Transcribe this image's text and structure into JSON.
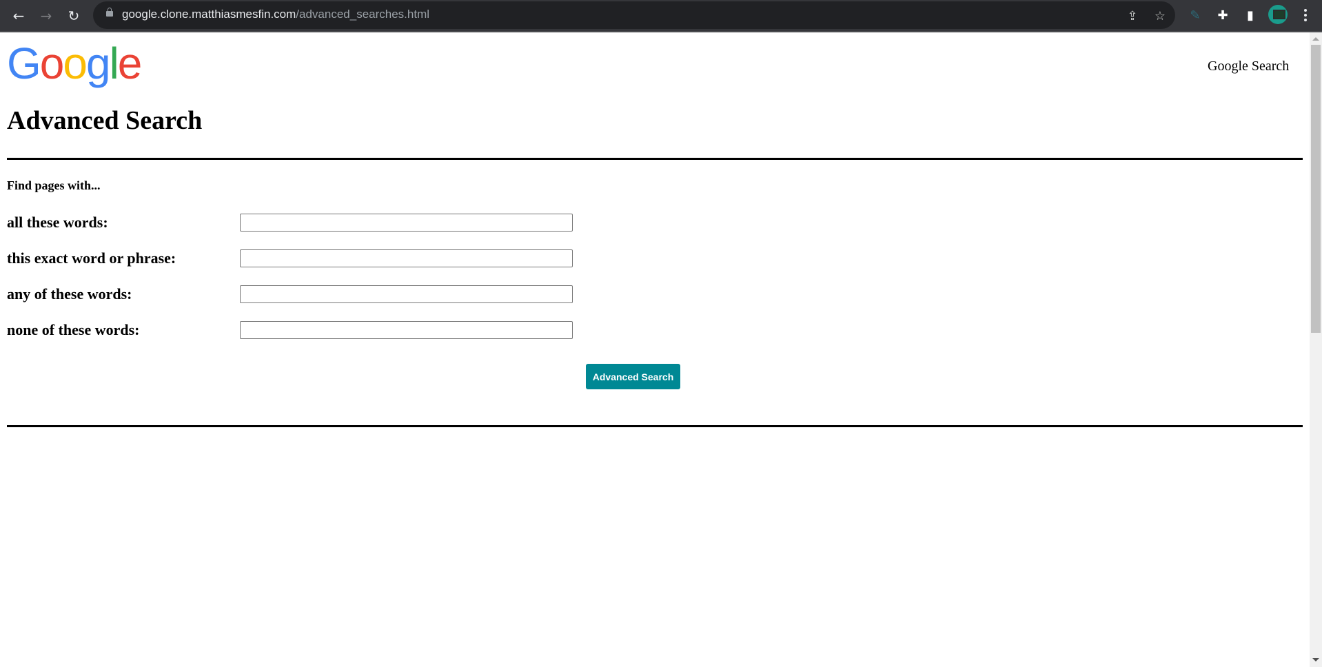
{
  "browser": {
    "url_host": "google.clone.matthiasmesfin.com",
    "url_path": "/advanced_searches.html",
    "back_icon": "←",
    "forward_icon": "→",
    "reload_icon": "↻",
    "share_icon": "⇪",
    "star_icon": "☆",
    "extension_icon": "✎",
    "puzzle_icon": "✚",
    "sidepanel_icon": "▮"
  },
  "header": {
    "logo": [
      "G",
      "o",
      "o",
      "g",
      "l",
      "e"
    ],
    "google_search_link": "Google Search"
  },
  "main": {
    "title": "Advanced Search",
    "subtitle": "Find pages with...",
    "fields": [
      {
        "label": "all these words:",
        "value": "",
        "placeholder": ""
      },
      {
        "label": "this exact word or phrase:",
        "value": "",
        "placeholder": ""
      },
      {
        "label": "any of these words:",
        "value": "",
        "placeholder": ""
      },
      {
        "label": "none of these words:",
        "value": "",
        "placeholder": ""
      }
    ],
    "submit_label": "Advanced Search"
  },
  "colors": {
    "button": "#008894",
    "chrome": "#35363a",
    "urlbar": "#202124"
  }
}
